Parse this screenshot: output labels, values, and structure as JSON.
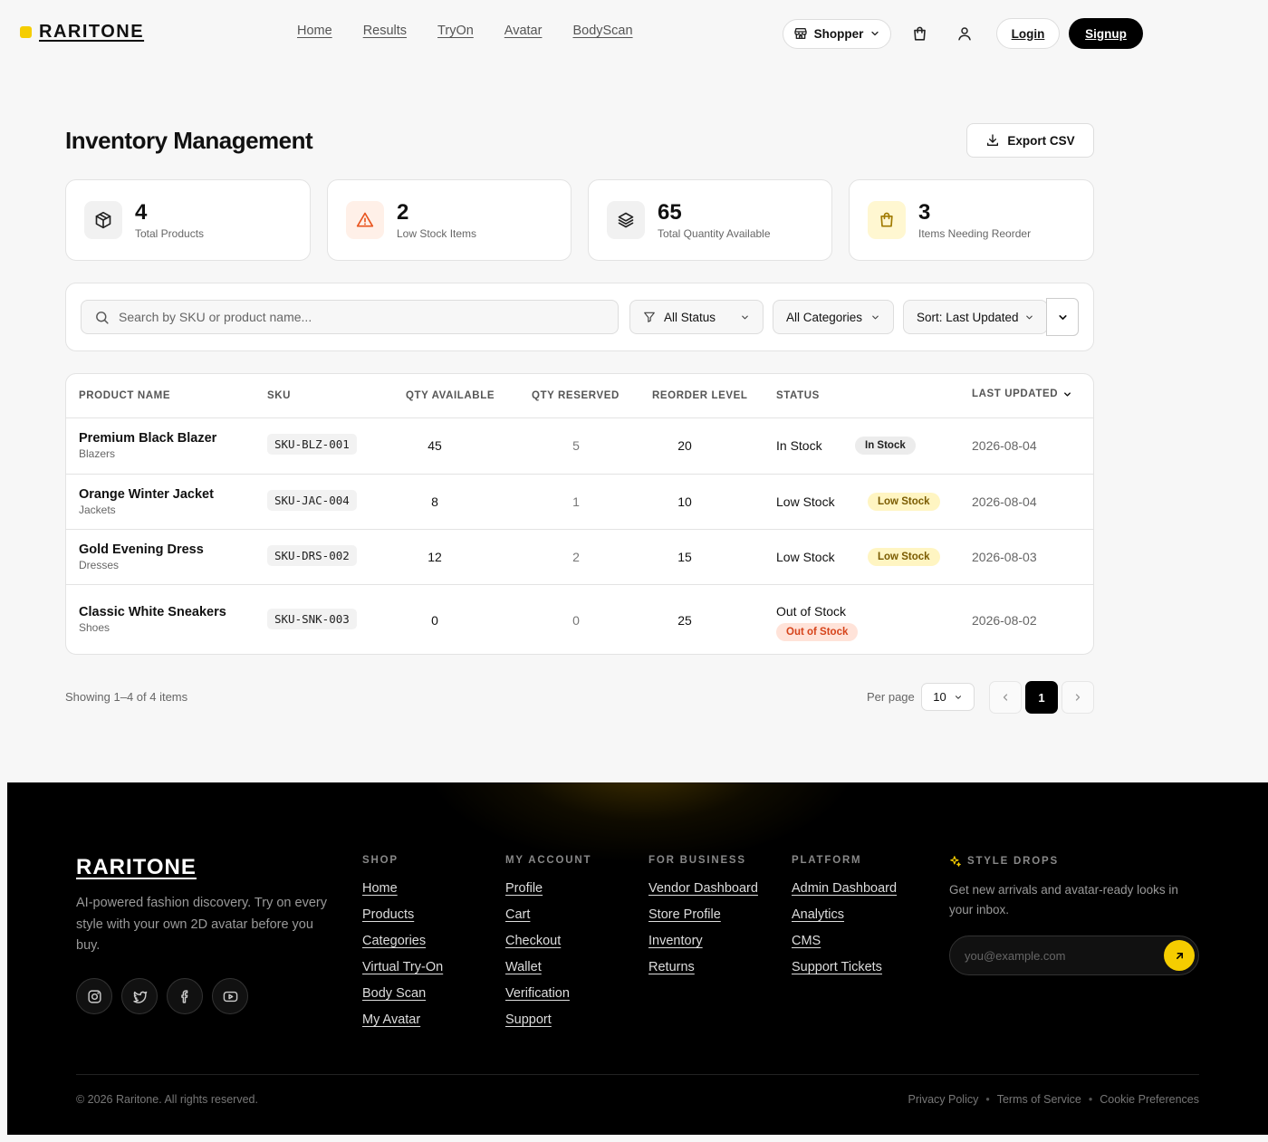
{
  "brand": {
    "name": "RARITONE"
  },
  "nav": {
    "items": [
      "Home",
      "Results",
      "TryOn",
      "Avatar",
      "BodyScan"
    ]
  },
  "header": {
    "role": "Shopper",
    "login": "Login",
    "signup": "Signup"
  },
  "page": {
    "title": "Inventory Management",
    "export_label": "Export CSV"
  },
  "stats": [
    {
      "value": "4",
      "label": "Total Products",
      "icon": "package-icon",
      "bg": "#f1f1f1",
      "color": "#222"
    },
    {
      "value": "2",
      "label": "Low Stock Items",
      "icon": "alert-triangle-icon",
      "bg": "#fff0e8",
      "color": "#e8541e"
    },
    {
      "value": "65",
      "label": "Total Quantity Available",
      "icon": "layers-icon",
      "bg": "#f1f1f1",
      "color": "#222"
    },
    {
      "value": "3",
      "label": "Items Needing Reorder",
      "icon": "shopping-bag-icon",
      "bg": "#fff7d1",
      "color": "#a07a00"
    }
  ],
  "filters": {
    "search_placeholder": "Search by SKU or product name...",
    "status": "All Status",
    "category": "All Categories",
    "sort": "Sort: Last Updated"
  },
  "table": {
    "headers": [
      "PRODUCT NAME",
      "SKU",
      "QTY AVAILABLE",
      "QTY RESERVED",
      "REORDER LEVEL",
      "STATUS",
      "LAST UPDATED"
    ],
    "rows": [
      {
        "name": "Premium Black Blazer",
        "category": "Blazers",
        "sku": "SKU-BLZ-001",
        "qty": "45",
        "reserved": "5",
        "reorder": "20",
        "status": "In Stock",
        "badge": "In Stock",
        "updated": "2026-08-04"
      },
      {
        "name": "Orange Winter Jacket",
        "category": "Jackets",
        "sku": "SKU-JAC-004",
        "qty": "8",
        "reserved": "1",
        "reorder": "10",
        "status": "Low Stock",
        "badge": "Low Stock",
        "updated": "2026-08-04"
      },
      {
        "name": "Gold Evening Dress",
        "category": "Dresses",
        "sku": "SKU-DRS-002",
        "qty": "12",
        "reserved": "2",
        "reorder": "15",
        "status": "Low Stock",
        "badge": "Low Stock",
        "updated": "2026-08-03"
      },
      {
        "name": "Classic White Sneakers",
        "category": "Shoes",
        "sku": "SKU-SNK-003",
        "qty": "0",
        "reserved": "0",
        "reorder": "25",
        "status": "Out of Stock",
        "badge": "Out of Stock",
        "updated": "2026-08-02"
      }
    ]
  },
  "pagination": {
    "showing": "Showing 1–4 of 4 items",
    "per_page_label": "Per page",
    "per_page": "10",
    "current": "1"
  },
  "footer": {
    "brand": "RARITONE",
    "desc": "AI-powered fashion discovery. Try on every style with your own 2D avatar before you buy.",
    "columns": [
      {
        "title": "SHOP",
        "links": [
          "Home",
          "Products",
          "Categories",
          "Virtual Try-On",
          "Body Scan",
          "My Avatar"
        ]
      },
      {
        "title": "MY ACCOUNT",
        "links": [
          "Profile",
          "Cart",
          "Checkout",
          "Wallet",
          "Verification",
          "Support"
        ]
      },
      {
        "title": "FOR BUSINESS",
        "links": [
          "Vendor Dashboard",
          "Store Profile",
          "Inventory",
          "Returns"
        ]
      },
      {
        "title": "PLATFORM",
        "links": [
          "Admin Dashboard",
          "Analytics",
          "CMS",
          "Support Tickets"
        ]
      }
    ],
    "drops_title": "STYLE DROPS",
    "drops_desc": "Get new arrivals and avatar-ready looks in your inbox.",
    "email_placeholder": "you@example.com",
    "copyright": "© 2026 Raritone. All rights reserved.",
    "legal": [
      "Privacy Policy",
      "Terms of Service",
      "Cookie Preferences"
    ]
  }
}
